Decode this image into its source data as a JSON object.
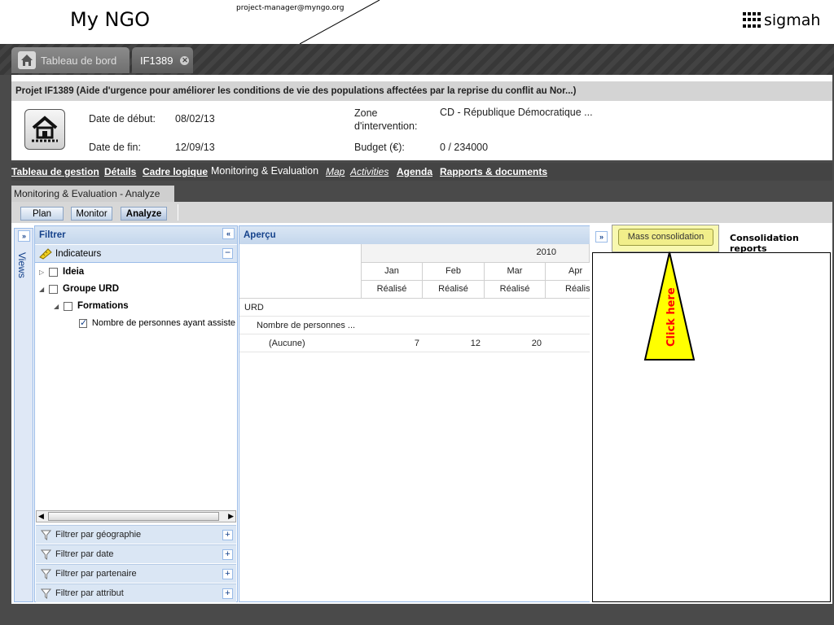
{
  "header": {
    "app_title": "My NGO",
    "user_email": "project-manager@myngo.org",
    "logo_text": "sigmah"
  },
  "tabs": [
    {
      "label": "Tableau de bord"
    },
    {
      "label": "IF1389"
    }
  ],
  "project": {
    "title": "Projet IF1389 (Aide d'urgence pour améliorer les conditions de vie des populations affectées par la reprise du conflit au Nor...)",
    "start_label": "Date de début:",
    "start_value": "08/02/13",
    "end_label": "Date de fin:",
    "end_value": "12/09/13",
    "zone_label": "Zone d'intervention:",
    "zone_value": "CD - République Démocratique ...",
    "budget_label": "Budget (€):",
    "budget_value": "0 / 234000"
  },
  "nav": {
    "items": [
      "Tableau de gestion",
      "Détails",
      "Cadre logique",
      "Monitoring & Evaluation",
      "Map",
      "Activities",
      "Agenda",
      "Rapports & documents"
    ],
    "active": "Monitoring & Evaluation"
  },
  "section": {
    "title": "Monitoring & Evaluation - Analyze",
    "buttons": [
      "Plan",
      "Monitor",
      "Analyze"
    ],
    "active": "Analyze"
  },
  "views_label": "Views",
  "filter": {
    "title": "Filtrer",
    "indicators_label": "Indicateurs",
    "tree": [
      {
        "label": "Ideia",
        "checked": false
      },
      {
        "label": "Groupe URD",
        "checked": false
      },
      {
        "label": "Formations",
        "checked": false
      },
      {
        "label": "Nombre de personnes ayant assiste",
        "checked": true
      }
    ],
    "sections": [
      "Filtrer par géographie",
      "Filtrer par date",
      "Filtrer par partenaire",
      "Filtrer par attribut"
    ]
  },
  "apercu": {
    "title": "Aperçu",
    "year": "2010",
    "months": [
      "Jan",
      "Feb",
      "Mar",
      "Apr"
    ],
    "measure": "Réalisé",
    "rows": {
      "group": "URD",
      "indicator": "Nombre de personnes ...",
      "sub": "(Aucune)",
      "values": [
        "7",
        "12",
        "20"
      ]
    }
  },
  "consolidation": {
    "mass_button": "Mass consolidation",
    "title": "Consolidation reports",
    "callout_text": "Click here"
  },
  "colors": {
    "panel_border": "#99bbe8",
    "panel_header": "#dae6f4",
    "callout_fill": "#ffff00",
    "callout_text": "#ff0000"
  }
}
